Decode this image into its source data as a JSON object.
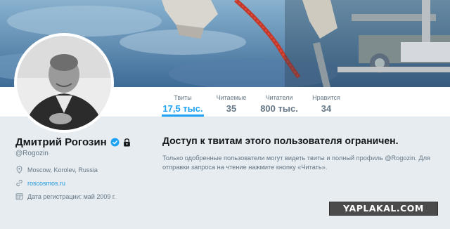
{
  "profile": {
    "name": "Дмитрий Рогозин",
    "handle": "@Rogozin",
    "location": "Moscow, Korolev, Russia",
    "website": "roscosmos.ru",
    "joined": "Дата регистрации: май 2009 г."
  },
  "stats": [
    {
      "label": "Твиты",
      "value": "17,5 тыс.",
      "active": true
    },
    {
      "label": "Читаемые",
      "value": "35",
      "active": false
    },
    {
      "label": "Читатели",
      "value": "800 тыс.",
      "active": false
    },
    {
      "label": "Нравится",
      "value": "34",
      "active": false
    }
  ],
  "protected": {
    "title": "Доступ к твитам этого пользователя ограничен.",
    "text": "Только одобренные пользователи могут видеть твиты и полный профиль @Rogozin. Для отправки запроса на чтение нажмите кнопку «Читать»."
  },
  "watermark": "YAPLAKAL.COM",
  "colors": {
    "accent": "#1da1f2",
    "link": "#1b95e0",
    "muted": "#657786",
    "background": "#e6ecf0"
  },
  "icons": {
    "verified": "verified-badge-icon",
    "lock": "lock-icon",
    "location": "location-pin-icon",
    "link": "link-icon",
    "calendar": "calendar-icon"
  }
}
